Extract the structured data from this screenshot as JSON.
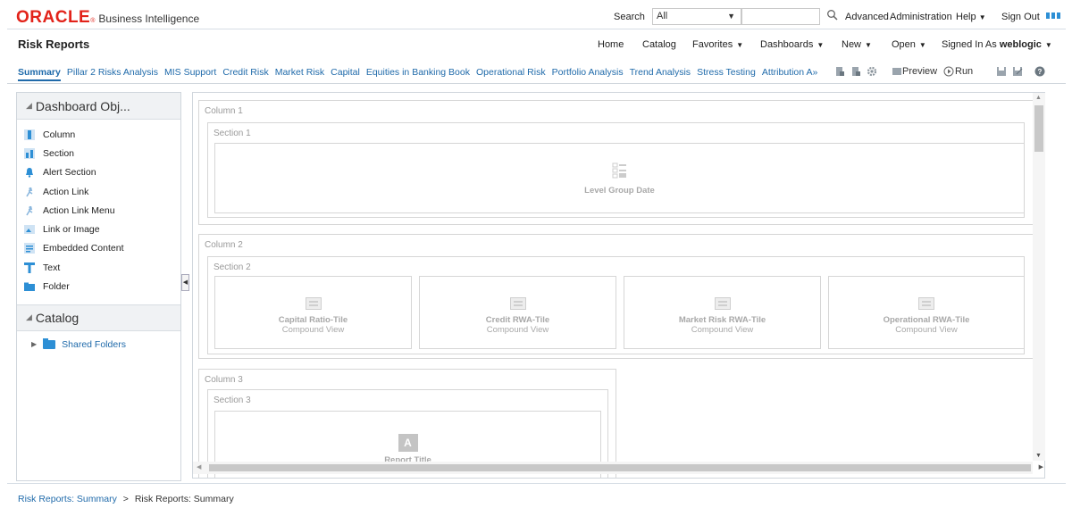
{
  "brand": {
    "oracle": "ORACLE",
    "product": "Business Intelligence"
  },
  "topbar": {
    "search_label": "Search",
    "search_scope": "All",
    "search_placeholder": "",
    "advanced": "Advanced",
    "administration": "Administration",
    "help": "Help",
    "sign_out": "Sign Out"
  },
  "header": {
    "title": "Risk Reports",
    "home": "Home",
    "catalog": "Catalog",
    "favorites": "Favorites",
    "dashboards": "Dashboards",
    "new": "New",
    "open": "Open",
    "signed_in_prefix": "Signed In As",
    "user": "weblogic"
  },
  "tabs": [
    {
      "label": "Summary",
      "active": true
    },
    {
      "label": "Pillar 2 Risks Analysis"
    },
    {
      "label": "MIS Support"
    },
    {
      "label": "Credit Risk"
    },
    {
      "label": "Market Risk"
    },
    {
      "label": "Capital"
    },
    {
      "label": "Equities in Banking Book"
    },
    {
      "label": "Operational Risk"
    },
    {
      "label": "Portfolio Analysis"
    },
    {
      "label": "Trend Analysis"
    },
    {
      "label": "Stress Testing"
    },
    {
      "label": "Attribution A"
    }
  ],
  "toolbar": {
    "preview": "Preview",
    "run": "Run"
  },
  "left_panel": {
    "dashboard_objects_title": "Dashboard Obj...",
    "objects": [
      {
        "label": "Column",
        "icon": "column-icon"
      },
      {
        "label": "Section",
        "icon": "section-icon"
      },
      {
        "label": "Alert Section",
        "icon": "alert-icon"
      },
      {
        "label": "Action Link",
        "icon": "action-link-icon"
      },
      {
        "label": "Action Link Menu",
        "icon": "action-link-menu-icon"
      },
      {
        "label": "Link or Image",
        "icon": "link-image-icon"
      },
      {
        "label": "Embedded Content",
        "icon": "embedded-content-icon"
      },
      {
        "label": "Text",
        "icon": "text-icon"
      },
      {
        "label": "Folder",
        "icon": "folder-icon"
      }
    ],
    "catalog_title": "Catalog",
    "shared_folders": "Shared Folders"
  },
  "canvas": {
    "column1": {
      "label": "Column 1",
      "section": "Section 1",
      "view": "Level Group Date"
    },
    "column2": {
      "label": "Column 2",
      "section": "Section 2",
      "views": [
        {
          "title": "Capital Ratio-Tile",
          "sub": "Compound View"
        },
        {
          "title": "Credit RWA-Tile",
          "sub": "Compound View"
        },
        {
          "title": "Market Risk RWA-Tile",
          "sub": "Compound View"
        },
        {
          "title": "Operational RWA-Tile",
          "sub": "Compound View"
        }
      ]
    },
    "column3": {
      "label": "Column 3",
      "section": "Section 3",
      "view": "Report Title",
      "icon_letter": "A"
    }
  },
  "breadcrumb": {
    "link": "Risk Reports: Summary",
    "current": "Risk Reports: Summary"
  },
  "colors": {
    "oracle_red": "#e2231a",
    "link_blue": "#1f6aaa",
    "accent_blue": "#2d8fd5"
  }
}
